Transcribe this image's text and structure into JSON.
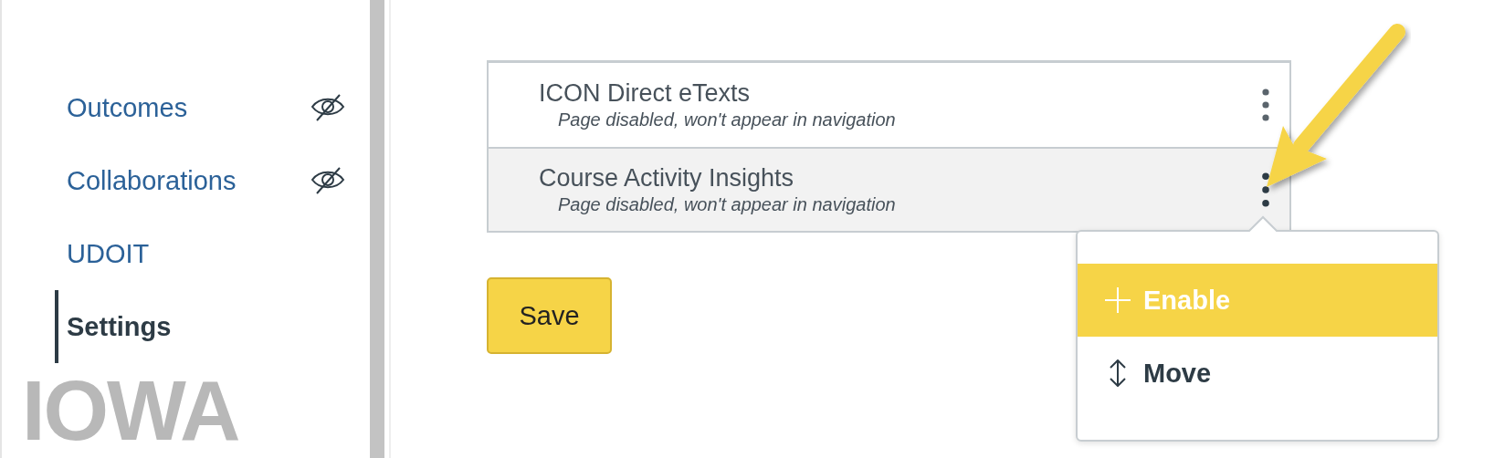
{
  "sidebar": {
    "items": [
      {
        "label": "Outcomes",
        "hidden": true,
        "selected": false
      },
      {
        "label": "Collaborations",
        "hidden": true,
        "selected": false
      },
      {
        "label": "UDOIT",
        "hidden": false,
        "selected": false
      },
      {
        "label": "Settings",
        "hidden": false,
        "selected": true
      }
    ],
    "logo": "IOWA"
  },
  "tool_list": {
    "items": [
      {
        "title": "ICON Direct eTexts",
        "note": "Page disabled, won't appear in navigation",
        "highlighted": false
      },
      {
        "title": "Course Activity Insights",
        "note": "Page disabled, won't appear in navigation",
        "highlighted": true
      }
    ]
  },
  "save_button": "Save",
  "menu": {
    "items": [
      {
        "label": "Enable",
        "kind": "enable",
        "selected": true
      },
      {
        "label": "Move",
        "kind": "move",
        "selected": false
      }
    ]
  }
}
